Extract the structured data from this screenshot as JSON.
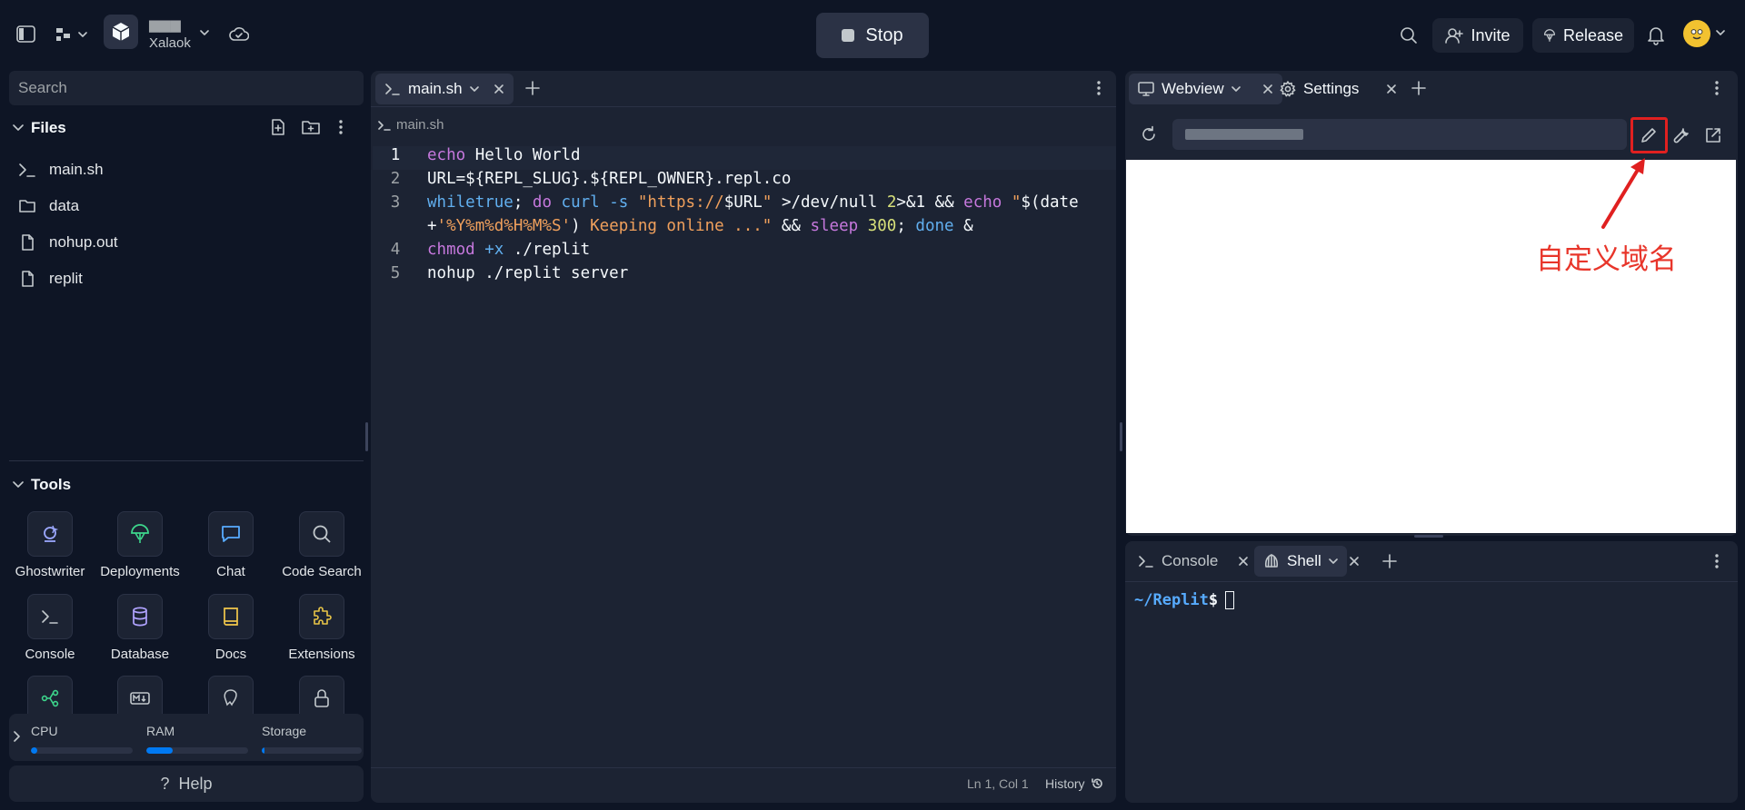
{
  "topbar": {
    "project_name": "▆▆▆",
    "owner": "Xalaok",
    "stop_label": "Stop",
    "invite_label": "Invite",
    "release_label": "Release"
  },
  "sidebar": {
    "search_placeholder": "Search",
    "files_title": "Files",
    "files": [
      {
        "name": "main.sh",
        "icon": "terminal-icon"
      },
      {
        "name": "data",
        "icon": "folder-icon"
      },
      {
        "name": "nohup.out",
        "icon": "file-icon"
      },
      {
        "name": "replit",
        "icon": "file-icon"
      }
    ],
    "tools_title": "Tools",
    "tools": [
      {
        "label": "Ghostwriter",
        "icon": "ghostwriter-icon",
        "color": "#9ca8ff"
      },
      {
        "label": "Deployments",
        "icon": "deployments-icon",
        "color": "#3dd68c"
      },
      {
        "label": "Chat",
        "icon": "chat-icon",
        "color": "#57abff"
      },
      {
        "label": "Code Search",
        "icon": "search-icon",
        "color": "#c2c8cc"
      },
      {
        "label": "Console",
        "icon": "terminal-icon",
        "color": "#c2c8cc"
      },
      {
        "label": "Database",
        "icon": "database-icon",
        "color": "#b0a3ff"
      },
      {
        "label": "Docs",
        "icon": "docs-icon",
        "color": "#f2c84b"
      },
      {
        "label": "Extensions",
        "icon": "extensions-icon",
        "color": "#e8c547"
      }
    ],
    "resources": {
      "cpu_label": "CPU",
      "ram_label": "RAM",
      "storage_label": "Storage",
      "cpu": 0.06,
      "ram": 0.26,
      "storage": 0.03
    },
    "help_label": "Help"
  },
  "editor": {
    "tab_label": "main.sh",
    "breadcrumb": "main.sh",
    "status_position": "Ln 1, Col 1",
    "history_label": "History"
  },
  "webview": {
    "tab_label": "Webview",
    "settings_tab_label": "Settings",
    "annotation": "自定义域名"
  },
  "shell": {
    "console_tab": "Console",
    "shell_tab": "Shell",
    "prompt_path": "~/Replit",
    "prompt_sign": "$"
  }
}
